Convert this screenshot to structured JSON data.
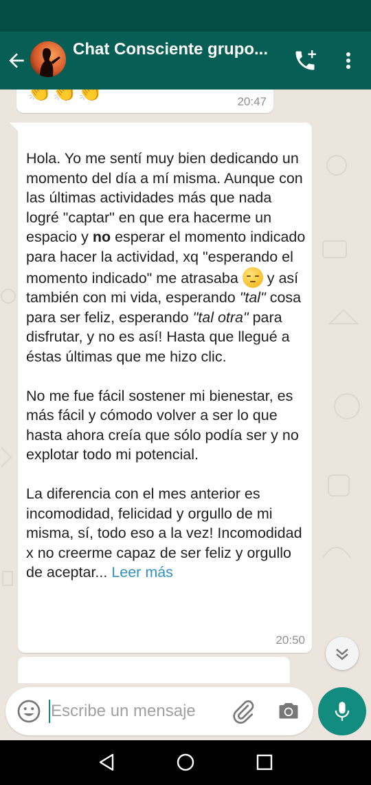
{
  "header": {
    "title": "Chat Consciente grupo...",
    "back_icon": "arrow-left-icon",
    "call_icon": "add-call-icon",
    "menu_icon": "more-vert-icon"
  },
  "colors": {
    "header": "#075e54",
    "status_bar": "#054d44",
    "accent": "#128c7e",
    "chat_background": "#ece5dd",
    "link": "#2f8fbf"
  },
  "messages": [
    {
      "id": "m1",
      "content": "👏👏👏",
      "time": "20:47"
    },
    {
      "id": "m2",
      "time": "20:50",
      "read_more": "Leer más",
      "segments": {
        "p1_a": "Hola. Yo me sentí muy bien dedicando un momento del día a mí misma.  Aunque con las últimas actividades más que nada logré \"captar\" en que era hacerme un espacio y ",
        "p1_bold": "no",
        "p1_b": " esperar el momento indicado para hacer la actividad,  xq \"esperando el momento indicado\" me atrasaba ",
        "p1_c": " y así también con mi vida, esperando ",
        "p1_italic1": "\"tal\"",
        "p1_d": " cosa para ser feliz,  esperando ",
        "p1_italic2": "\"tal otra\"",
        "p1_e": " para disfrutar, y no es así! Hasta que llegué a éstas últimas que me hizo clic.",
        "p2": "No me fue fácil sostener mi bienestar, es más fácil  y cómodo volver a ser lo que hasta ahora creía que sólo podía ser y no explotar todo mi potencial.",
        "p3": "La diferencia con el mes anterior es incomodidad, felicidad y orgullo de mi misma,  sí, todo eso a la vez! Incomodidad x no creerme capaz de ser feliz y orgullo de aceptar... "
      },
      "emoji": "pensive-face-icon"
    }
  ],
  "scroll_down_icon": "double-chevron-down-icon",
  "composer": {
    "placeholder": "Escribe un mensaje",
    "value": "",
    "emoji_icon": "smiley-icon",
    "attach_icon": "paperclip-icon",
    "camera_icon": "camera-icon",
    "mic_icon": "microphone-icon"
  },
  "navigation": {
    "back_icon": "triangle-back-icon",
    "home_icon": "circle-home-icon",
    "recents_icon": "square-recents-icon"
  }
}
